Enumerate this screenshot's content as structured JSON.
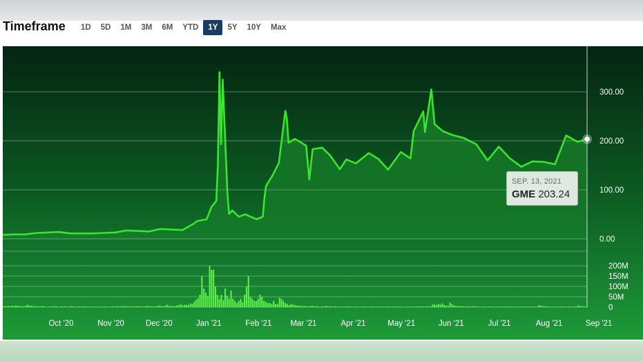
{
  "timeframe": {
    "title": "Timeframe",
    "tabs": [
      "1D",
      "5D",
      "1M",
      "3M",
      "6M",
      "YTD",
      "1Y",
      "5Y",
      "10Y",
      "Max"
    ],
    "active": "1Y"
  },
  "tooltip": {
    "date": "SEP. 13, 2021",
    "symbol": "GME",
    "value": "203.24"
  },
  "colors": {
    "line": "#39e62b",
    "accent": "#1a3d66",
    "background_top": "#042a14",
    "background_bottom": "#1a8a34"
  },
  "chart_data": {
    "type": "line",
    "title": "",
    "xlabel": "",
    "ylabel": "",
    "x_ticks": [
      "Oct '20",
      "Nov '20",
      "Dec '20",
      "Jan '21",
      "Feb '21",
      "Mar '21",
      "Apr '21",
      "May '21",
      "Jun '21",
      "Jul '21",
      "Aug '21",
      "Sep '21"
    ],
    "price": {
      "y_ticks": [
        "300.00",
        "200.00",
        "100.00",
        "0.00"
      ],
      "ylim": [
        0,
        330
      ],
      "series": [
        {
          "name": "GME",
          "x": [
            "2020-09-14",
            "2020-09-21",
            "2020-09-28",
            "2020-10-05",
            "2020-10-12",
            "2020-10-19",
            "2020-10-26",
            "2020-11-02",
            "2020-11-09",
            "2020-11-16",
            "2020-11-23",
            "2020-11-30",
            "2020-12-07",
            "2020-12-14",
            "2020-12-21",
            "2020-12-28",
            "2021-01-04",
            "2021-01-11",
            "2021-01-13",
            "2021-01-19",
            "2021-01-22",
            "2021-01-25",
            "2021-01-26",
            "2021-01-27",
            "2021-01-28",
            "2021-01-29",
            "2021-02-01",
            "2021-02-02",
            "2021-02-04",
            "2021-02-08",
            "2021-02-12",
            "2021-02-19",
            "2021-02-23",
            "2021-02-24",
            "2021-02-25",
            "2021-03-01",
            "2021-03-05",
            "2021-03-09",
            "2021-03-10",
            "2021-03-11",
            "2021-03-15",
            "2021-03-22",
            "2021-03-24",
            "2021-03-26",
            "2021-04-01",
            "2021-04-06",
            "2021-04-12",
            "2021-04-16",
            "2021-04-22",
            "2021-04-30",
            "2021-05-06",
            "2021-05-12",
            "2021-05-20",
            "2021-05-26",
            "2021-05-28",
            "2021-06-03",
            "2021-06-04",
            "2021-06-08",
            "2021-06-10",
            "2021-06-15",
            "2021-06-21",
            "2021-06-28",
            "2021-07-06",
            "2021-07-13",
            "2021-07-20",
            "2021-07-27",
            "2021-08-03",
            "2021-08-10",
            "2021-08-17",
            "2021-08-24",
            "2021-08-31",
            "2021-09-07",
            "2021-09-13"
          ],
          "y": [
            8,
            9,
            9,
            12,
            13,
            14,
            11,
            11,
            11,
            12,
            13,
            17,
            16,
            15,
            20,
            19,
            18,
            31,
            36,
            40,
            65,
            77,
            148,
            340,
            193,
            325,
            89,
            51,
            58,
            45,
            50,
            40,
            45,
            82,
            108,
            129,
            155,
            261,
            245,
            196,
            204,
            190,
            121,
            183,
            186,
            170,
            142,
            162,
            154,
            175,
            163,
            141,
            177,
            164,
            220,
            260,
            218,
            305,
            234,
            220,
            212,
            206,
            193,
            160,
            188,
            164,
            147,
            158,
            157,
            152,
            211,
            198,
            203.24
          ]
        }
      ]
    },
    "volume": {
      "y_ticks": [
        "200M",
        "150M",
        "100M",
        "50M",
        "0"
      ],
      "ylim": [
        0,
        220
      ],
      "unit": "M",
      "values": [
        5,
        4,
        6,
        5,
        7,
        5,
        9,
        6,
        5,
        5,
        4,
        6,
        12,
        8,
        7,
        5,
        4,
        5,
        3,
        4,
        6,
        3,
        2,
        3,
        4,
        3,
        5,
        4,
        2,
        3,
        4,
        3,
        3,
        2,
        4,
        5,
        3,
        2,
        4,
        3,
        3,
        4,
        3,
        2,
        3,
        3,
        2,
        3,
        3,
        2,
        2,
        3,
        4,
        3,
        2,
        3,
        4,
        3,
        5,
        4,
        3,
        6,
        4,
        5,
        3,
        4,
        4,
        3,
        5,
        4,
        4,
        3,
        3,
        5,
        6,
        4,
        4,
        3,
        4,
        6,
        8,
        5,
        4,
        6,
        12,
        6,
        7,
        5,
        5,
        8,
        10,
        14,
        8,
        11,
        12,
        10,
        18,
        16,
        25,
        35,
        42,
        60,
        150,
        90,
        70,
        55,
        200,
        180,
        180,
        100,
        60,
        40,
        60,
        35,
        90,
        55,
        40,
        80,
        40,
        30,
        20,
        30,
        40,
        25,
        60,
        100,
        150,
        50,
        40,
        30,
        30,
        40,
        60,
        50,
        30,
        25,
        20,
        20,
        15,
        30,
        15,
        15,
        45,
        40,
        30,
        20,
        15,
        10,
        15,
        12,
        10,
        8,
        7,
        6,
        6,
        5,
        5,
        4,
        6,
        6,
        4,
        5,
        4,
        3,
        4,
        3,
        6,
        4,
        5,
        3,
        3,
        4,
        3,
        3,
        3,
        2,
        3,
        4,
        3,
        3,
        2,
        3,
        2,
        2,
        2,
        3,
        3,
        2,
        2,
        3,
        3,
        2,
        2,
        2,
        3,
        2,
        2,
        3,
        3,
        2,
        2,
        3,
        3,
        3,
        3,
        2,
        2,
        2,
        3,
        3,
        2,
        3,
        3,
        4,
        3,
        4,
        3,
        3,
        4,
        3,
        4,
        12,
        14,
        10,
        16,
        12,
        18,
        10,
        8,
        6,
        22,
        14,
        9,
        6,
        5,
        5,
        4,
        4,
        3,
        4,
        3,
        3,
        5,
        4,
        3,
        3,
        2,
        3,
        2,
        2,
        3,
        3,
        2,
        2,
        3,
        2,
        3,
        2,
        3,
        3,
        3,
        3,
        2,
        3,
        2,
        2,
        2,
        3,
        3,
        2,
        2,
        2,
        3,
        2,
        3,
        3,
        10,
        7,
        5,
        4,
        3,
        3,
        2,
        3,
        2,
        2,
        2,
        3,
        2,
        3,
        2,
        3,
        3,
        2,
        4,
        3,
        8,
        6,
        5,
        4,
        3
      ]
    }
  }
}
